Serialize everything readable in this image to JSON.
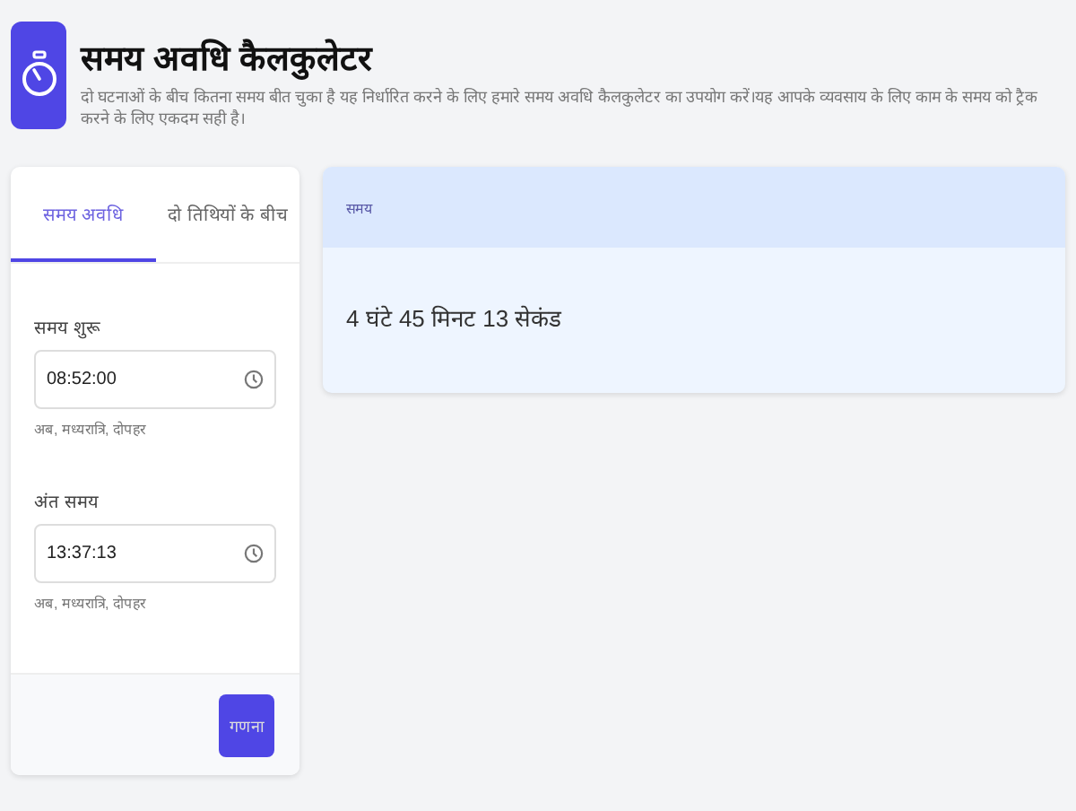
{
  "header": {
    "title": "समय अवधि कैलकुलेटर",
    "subtitle": "दो घटनाओं के बीच कितना समय बीत चुका है यह निर्धारित करने के लिए हमारे समय अवधि कैलकुलेटर का उपयोग करें।यह आपके व्यवसाय के लिए काम के समय को ट्रैक करने के लिए एकदम सही है।"
  },
  "tabs": [
    {
      "label": "समय अवधि",
      "selected": true
    },
    {
      "label": "दो तिथियों के बीच",
      "selected": false
    }
  ],
  "fields": [
    {
      "label": "समय शुरू",
      "value": "08:52:00",
      "hint": "अब, मध्यरात्रि, दोपहर"
    },
    {
      "label": "अंत समय",
      "value": "13:37:13",
      "hint": "अब, मध्यरात्रि, दोपहर"
    }
  ],
  "submit": "गणना",
  "result": {
    "heading": "समय",
    "value": "4 घंटे 45 मिनट 13 सेकंड"
  }
}
